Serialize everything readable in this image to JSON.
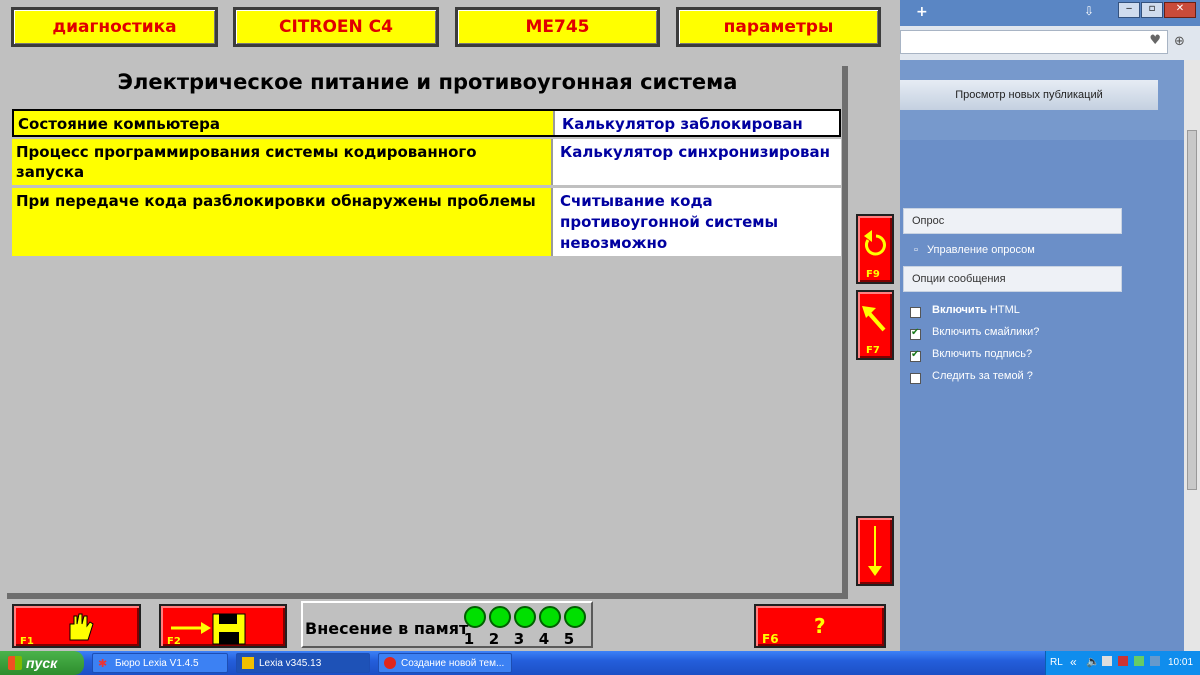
{
  "lexia": {
    "top_buttons": [
      "диагностика",
      "CITROEN C4",
      "ME745",
      "параметры"
    ],
    "panel_title": "Электрическое питание и противоугонная система",
    "rows": [
      {
        "label": "Состояние компьютера",
        "value": "Калькулятор заблокирован"
      },
      {
        "label": "Процесс программирования системы кодированного запуска",
        "value": "Калькулятор синхронизирован"
      },
      {
        "label": "При передаче кода разблокировки обнаружены проблемы",
        "value": "Считывание кода противоугонной системы невозможно"
      }
    ],
    "side_buttons": [
      {
        "icon": "undo-icon",
        "key": "F9"
      },
      {
        "icon": "arrow-up-left-icon",
        "key": "F7"
      },
      {
        "icon": "arrow-down-icon",
        "key": ""
      }
    ],
    "bottom_buttons": [
      {
        "icon": "hand-icon",
        "key": "F1"
      },
      {
        "icon": "save-to-disk-icon",
        "key": "F2"
      },
      {
        "icon": "help-icon",
        "key": "F6",
        "glyph": "?"
      }
    ],
    "memory": {
      "label": "Внесение в памят",
      "slots": [
        "1",
        "2",
        "3",
        "4",
        "5"
      ]
    },
    "colors": {
      "background": "#c0c0c0",
      "yellow": "#ffff00",
      "red": "#ff0000",
      "value_text": "#0000a0",
      "title_text": "#e00000"
    }
  },
  "browser": {
    "header": "Просмотр новых публикаций",
    "poll_box": "Опрос",
    "poll_link": "Управление опросом",
    "options_box": "Опции сообщения",
    "checkboxes": [
      {
        "label_bold": "Включить",
        "label": " HTML",
        "checked": false
      },
      {
        "label_bold": "",
        "label": "Включить смайлики?",
        "checked": true
      },
      {
        "label_bold": "",
        "label": "Включить подпись?",
        "checked": true
      },
      {
        "label_bold": "",
        "label": "Следить за темой ?",
        "checked": false
      }
    ]
  },
  "taskbar": {
    "start": "пуск",
    "tasks": [
      "Бюро Lexia V1.4.5",
      "Lexia v345.13",
      "Создание новой тем..."
    ],
    "active_task": 1,
    "tray": {
      "lang": "RL",
      "time": "10:01"
    }
  }
}
